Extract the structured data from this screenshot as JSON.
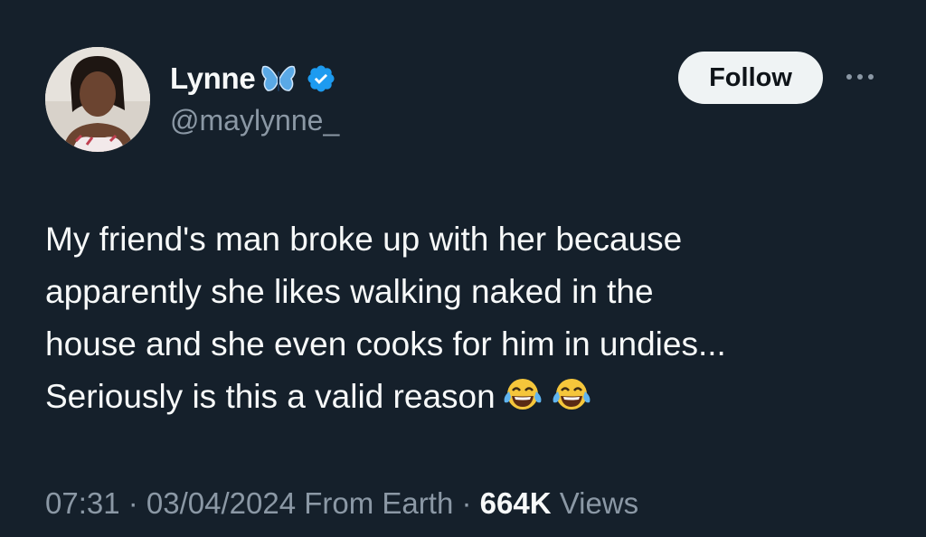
{
  "author": {
    "display_name": "Lynne",
    "handle": "@maylynne_",
    "badge_icons": [
      "butterfly-emoji-icon",
      "verified-badge-icon"
    ]
  },
  "actions": {
    "follow_label": "Follow",
    "more_icon": "more-horizontal-icon"
  },
  "tweet": {
    "text_lines": [
      "My friend's man broke up with her because",
      "apparently she likes walking naked in the",
      "house and she even cooks for him in undies...",
      "Seriously is this a valid reason"
    ],
    "emojis": [
      "tears-of-joy-emoji",
      "tears-of-joy-emoji"
    ]
  },
  "meta": {
    "time": "07:31",
    "separator": " · ",
    "date": "03/04/2024",
    "source": "From Earth",
    "views_count": "664K",
    "views_label": "Views"
  },
  "colors": {
    "background": "#15202b",
    "primary_text": "#f7f9f9",
    "secondary_text": "#8b98a5",
    "verified_blue": "#1d9bf0",
    "follow_bg": "#eff3f4"
  }
}
